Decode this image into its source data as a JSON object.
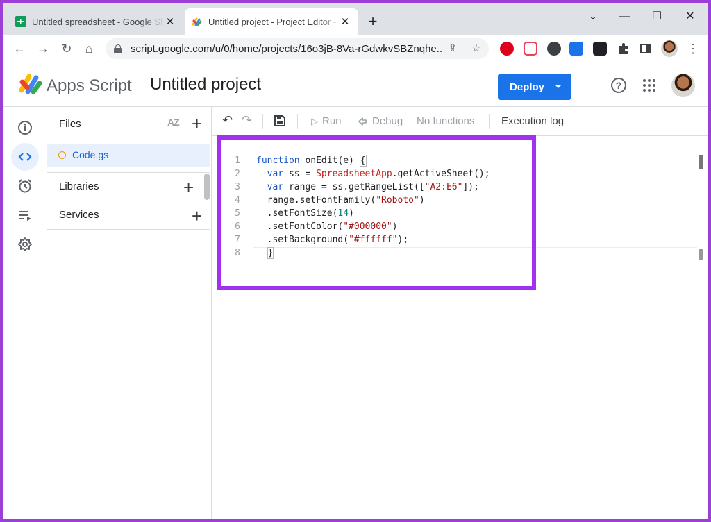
{
  "browser": {
    "tabs": [
      {
        "title": "Untitled spreadsheet - Google Sheets",
        "active": false,
        "favicon": "sheets-icon"
      },
      {
        "title": "Untitled project - Project Editor - Apps Script",
        "active": true,
        "favicon": "apps-script-icon"
      }
    ],
    "close_glyph": "✕",
    "new_tab_glyph": "+",
    "window_controls": {
      "collapse": "⌄",
      "minimize": "—",
      "maximize": "☐",
      "close": "✕"
    },
    "nav": {
      "back": "←",
      "forward": "→",
      "reload": "↻",
      "home": "⌂"
    },
    "url": "script.google.com/u/0/home/projects/16o3jB-8Va-rGdwkvSBZnqhe...",
    "share_glyph": "⇪",
    "bookmark_glyph": "☆",
    "menu_glyph": "⋮"
  },
  "header": {
    "brand": "Apps Script",
    "project_title": "Untitled project",
    "deploy_label": "Deploy",
    "help_glyph": "?"
  },
  "colors": {
    "accent": "#1a73e8",
    "highlight_frame": "#a230f0",
    "file_dot": "#f29900",
    "outer_border": "#9b3fd6"
  },
  "rail": {
    "items": [
      {
        "name": "overview-icon",
        "active": false
      },
      {
        "name": "editor-icon",
        "active": true
      },
      {
        "name": "triggers-icon",
        "active": false
      },
      {
        "name": "executions-icon",
        "active": false
      },
      {
        "name": "settings-icon",
        "active": false
      }
    ]
  },
  "files_panel": {
    "title": "Files",
    "sort_label": "AZ",
    "add_glyph": "+",
    "files": [
      {
        "name": "Code.gs",
        "selected": true
      }
    ],
    "libraries_label": "Libraries",
    "services_label": "Services"
  },
  "editor_toolbar": {
    "undo": "↶",
    "redo": "↷",
    "run_label": "Run",
    "run_glyph": "▷",
    "debug_label": "Debug",
    "function_select": "No functions",
    "execution_log_label": "Execution log"
  },
  "code": {
    "line_numbers": [
      "1",
      "2",
      "3",
      "4",
      "5",
      "6",
      "7",
      "8"
    ],
    "lines": [
      "function onEdit(e) {",
      "  var ss = SpreadsheetApp.getActiveSheet();",
      "  var range = ss.getRangeList([\"A2:E6\"]);",
      "  range.setFontFamily(\"Roboto\")",
      "  .setFontSize(14)",
      "  .setFontColor(\"#000000\")",
      "  .setBackground(\"#ffffff\");",
      "  }"
    ],
    "tokens": {
      "l1_kw": "function",
      "l1_rest": " onEdit(e) ",
      "l1_brace": "{",
      "l2_kw": "var",
      "l2_a": " ss = ",
      "l2_cls": "SpreadsheetApp",
      "l2_b": ".getActiveSheet();",
      "l3_kw": "var",
      "l3_a": " range = ss.getRangeList([",
      "l3_str": "\"A2:E6\"",
      "l3_b": "]);",
      "l4_a": "range.setFontFamily(",
      "l4_str": "\"Roboto\"",
      "l4_b": ")",
      "l5_a": ".setFontSize(",
      "l5_num": "14",
      "l5_b": ")",
      "l6_a": ".setFontColor(",
      "l6_str": "\"#000000\"",
      "l6_b": ")",
      "l7_a": ".setBackground(",
      "l7_str": "\"#ffffff\"",
      "l7_b": ");",
      "l8_brace": "}"
    }
  }
}
